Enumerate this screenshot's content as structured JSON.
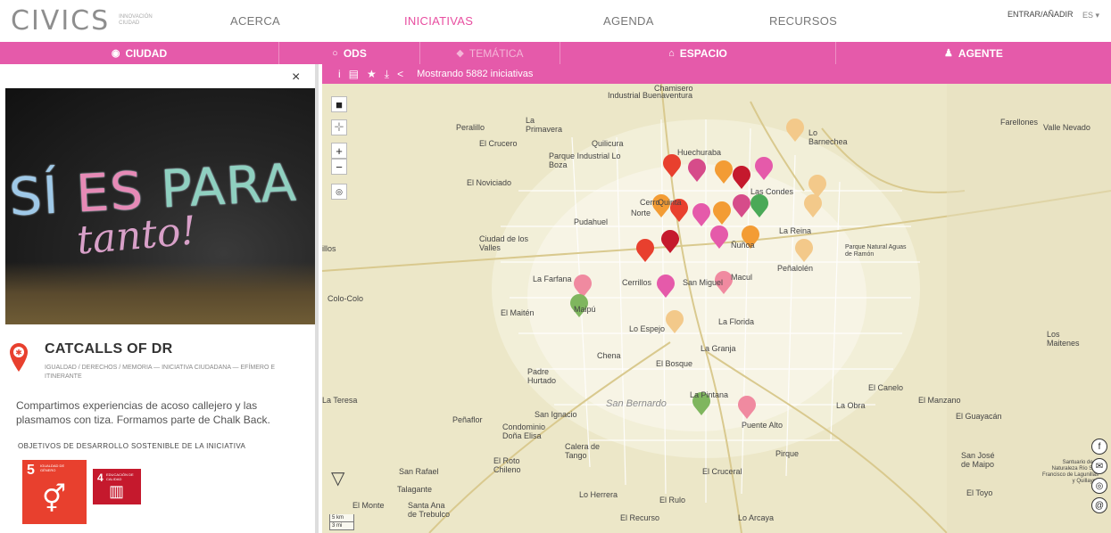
{
  "nav": {
    "logo": "CIVICS",
    "logo_sub": "INNOVACIÓN CIUDAD",
    "items": [
      {
        "label": "ACERCA",
        "active": false
      },
      {
        "label": "INICIATIVAS",
        "active": true
      },
      {
        "label": "AGENDA",
        "active": false
      },
      {
        "label": "RECURSOS",
        "active": false
      }
    ],
    "login": "ENTRAR/AÑADIR",
    "lang": "ES"
  },
  "filters": [
    {
      "label": "CIUDAD",
      "icon": "target-icon"
    },
    {
      "label": "ODS",
      "icon": "circle-icon"
    },
    {
      "label": "TEMÁTICA",
      "icon": "tag-icon"
    },
    {
      "label": "ESPACIO",
      "icon": "building-icon"
    },
    {
      "label": "AGENTE",
      "icon": "person-icon"
    }
  ],
  "panel": {
    "close": "×",
    "photo_text_1a": "SÍ",
    "photo_text_1b": "ES",
    "photo_text_1c": "PARA",
    "photo_text_2": "tanto!",
    "title": "CATCALLS OF DR",
    "tags": "IGUALDAD / DERECHOS / MEMORIA — INICIATIVA CIUDADANA — EFÍMERO E ITINERANTE",
    "description": "Compartimos experiencias de acoso callejero y las plasmamos con tiza. Formamos parte de Chalk Back.",
    "ods_heading": "OBJETIVOS DE DESARROLLO SOSTENIBLE DE LA INICIATIVA",
    "ods": [
      {
        "num": "5",
        "label": "IGUALDAD DE GÉNERO",
        "color": "#e8402e",
        "glyph": "⚥"
      },
      {
        "num": "4",
        "label": "EDUCACIÓN DE CALIDAD",
        "color": "#c5192d",
        "glyph": "▥"
      }
    ]
  },
  "map": {
    "toolbar_status": "Mostrando 5882 iniciativas",
    "controls": {
      "zoom_in": "+",
      "zoom_out": "−"
    },
    "scale_km": "5 km",
    "scale_mi": "3 mi",
    "labels": [
      "Industrial Buenaventura",
      "Chamisero",
      "Peralillo",
      "La Primavera",
      "El Crucero",
      "Quilicura",
      "Parque Industrial Lo Boza",
      "Huechuraba",
      "Lo Barnechea",
      "Farellones",
      "Valle Nevado",
      "El Noviciado",
      "Las Condes",
      "Pudahuel",
      "La Reina",
      "Ciudad de los Valles",
      "Ñuñoa",
      "Parque Natural Aguas de Ramón",
      "Peñalolén",
      "La Farfana",
      "Cerrillos",
      "San Miguel",
      "Macul",
      "Colo-Colo",
      "El Maitén",
      "Maipú",
      "La Florida",
      "Lo Espejo",
      "Los Maitenes",
      "La Granja",
      "Chena",
      "El Bosque",
      "Padre Hurtado",
      "El Canelo",
      "La Pintana",
      "El Manzano",
      "La Obra",
      "San Bernardo",
      "San Ignacio",
      "Peñaflor",
      "Condominio Doña Elisa",
      "El Guayacán",
      "Puente Alto",
      "Calera de Tango",
      "Pirque",
      "San José de Maipo",
      "San Rafael",
      "El Roto Chileno",
      "El Cruceral",
      "Talagante",
      "Santuario de la Naturaleza Río San Francisco de Lagunillas y Quillayes",
      "El Monte",
      "Santa Ana de Trebulco",
      "Lo Herrera",
      "El Rulo",
      "El Toyo",
      "El Recurso",
      "Lo Arcaya",
      "La Teresa",
      "illos",
      "Cerro",
      "Norte",
      "Quinta"
    ]
  },
  "colors": {
    "accent": "#e55aaa",
    "active_nav": "#e84ea0",
    "map_bg": "#ece7c8"
  }
}
